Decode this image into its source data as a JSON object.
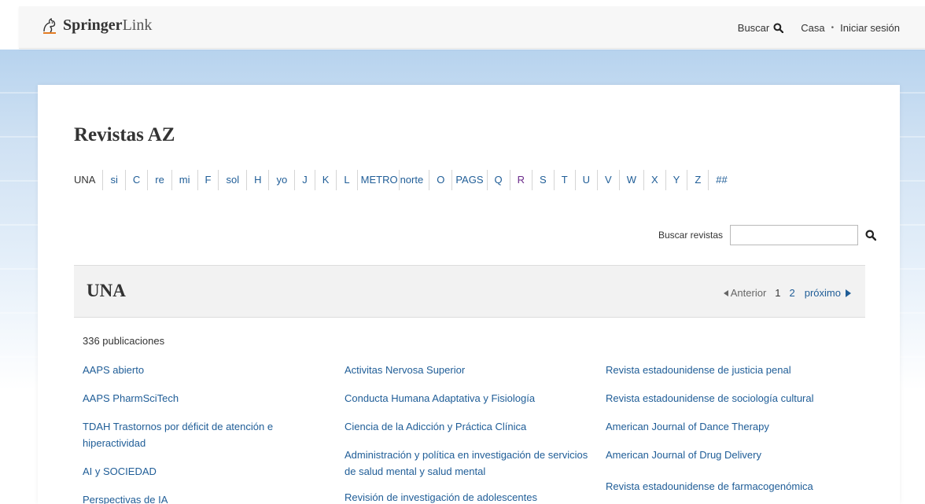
{
  "header": {
    "brand_bold": "Springer",
    "brand_light": "Link",
    "search_label": "Buscar",
    "home_label": "Casa",
    "separator": "•",
    "login_label": "Iniciar sesión",
    "icons": [
      "springer-horse-icon",
      "search-icon"
    ]
  },
  "page": {
    "title": "Revistas AZ"
  },
  "az_nav": [
    "UNA",
    "si",
    "C",
    "re",
    "mi",
    "F",
    "sol",
    "H",
    "yo",
    "J",
    "K",
    "L",
    "METRO",
    "norte",
    "O",
    "PAGS",
    "Q",
    "R",
    "S",
    "T",
    "U",
    "V",
    "W",
    "X",
    "Y",
    "Z",
    "##"
  ],
  "search": {
    "label": "Buscar revistas",
    "value": "",
    "placeholder": ""
  },
  "section": {
    "title": "UNA",
    "pager": {
      "prev": "Anterior",
      "pages": [
        "1",
        "2"
      ],
      "current": "1",
      "next": "próximo"
    },
    "count": "336 publicaciones"
  },
  "columns": [
    [
      "AAPS abierto",
      "AAPS PharmSciTech",
      "TDAH Trastornos por déficit de atención e hiperactividad",
      "AI y SOCIEDAD",
      "Perspectivas de IA"
    ],
    [
      "Activitas Nervosa Superior",
      "Conducta Humana Adaptativa y Fisiología",
      "Ciencia de la Adicción y Práctica Clínica",
      "Administración y política en investigación de servicios de salud mental y salud mental",
      "Revisión de investigación de adolescentes"
    ],
    [
      "Revista estadounidense de justicia penal",
      "Revista estadounidense de sociología cultural",
      "American Journal of Dance Therapy",
      "American Journal of Drug Delivery",
      "Revista estadounidense de farmacogenómica"
    ]
  ],
  "colors": {
    "link": "#1f5d97",
    "visited": "#6a2a8a",
    "text": "#333333",
    "banner": "#b7d3ee"
  }
}
